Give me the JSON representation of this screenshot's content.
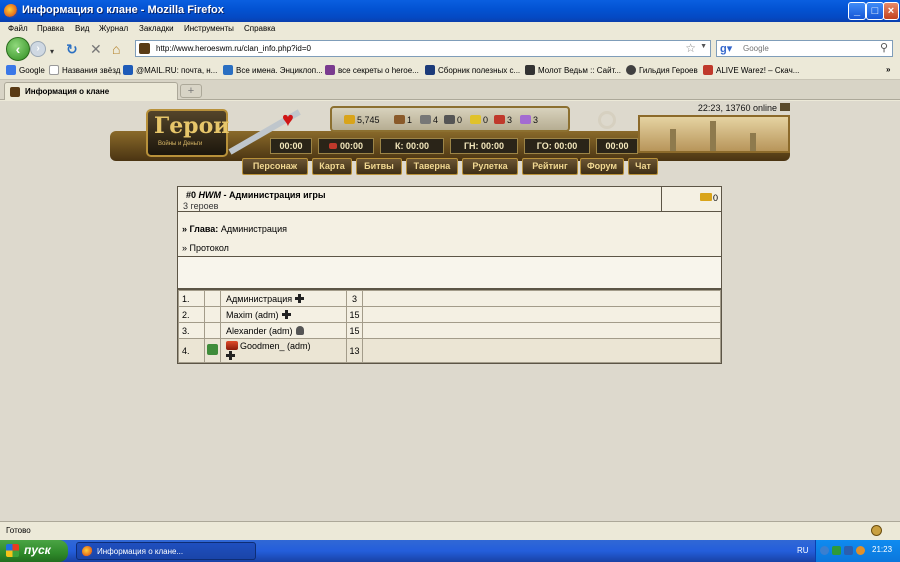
{
  "window": {
    "title": "Информация о клане - Mozilla Firefox",
    "minimize": "_",
    "maximize": "□",
    "close": "×"
  },
  "menu": [
    "Файл",
    "Правка",
    "Вид",
    "Журнал",
    "Закладки",
    "Инструменты",
    "Справка"
  ],
  "nav": {
    "url": "http://www.heroeswm.ru/clan_info.php?id=0",
    "search_placeholder": "Google"
  },
  "bookmarks": [
    {
      "label": "Google",
      "color": "#3b78e7"
    },
    {
      "label": "Названия звёзд",
      "color": "#dddddd"
    },
    {
      "label": "@MAIL.RU: почта, н...",
      "color": "#1e5bb8"
    },
    {
      "label": "Все имена. Энциклоп...",
      "color": "#2a6fc2"
    },
    {
      "label": "все секреты о heroe...",
      "color": "#7a3b8f"
    },
    {
      "label": "Сборник полезных с...",
      "color": "#1c3b7a"
    },
    {
      "label": "Молот Ведьм :: Сайт...",
      "color": "#333333"
    },
    {
      "label": "Гильдия Героев",
      "color": "#404040"
    },
    {
      "label": "ALIVE Warez! – Скач...",
      "color": "#c0392b"
    }
  ],
  "bookmarks_more": "»",
  "tab": {
    "label": "Информация о клане",
    "new_tab": "+"
  },
  "game": {
    "time_online": "22:23, 13760 online",
    "logo_title": "Герои",
    "logo_subtitle": "Войны и Деньги",
    "resources": [
      "5,745",
      "1",
      "4",
      "0",
      "0",
      "3",
      "3"
    ],
    "timers": [
      "00:00",
      "00:00",
      "К: 00:00",
      "ГН: 00:00",
      "ГО: 00:00",
      "00:00"
    ],
    "menu": [
      "Персонаж",
      "Карта",
      "Битвы",
      "Таверна",
      "Рулетка",
      "Рейтинг",
      "Форум",
      "Чат"
    ]
  },
  "clan": {
    "id_prefix": "#0",
    "tag": "HWM",
    "name_suffix": " - Администрация игры",
    "heroes_count": "3 героев",
    "gold": "0",
    "head_label": "» Глава:",
    "head_value": " Администрация",
    "protocol": "» Протокол",
    "members": [
      {
        "num": "1.",
        "name": "Администрация",
        "level": "3",
        "mark": "cross"
      },
      {
        "num": "2.",
        "name": "Maxim (adm)",
        "level": "15",
        "mark": "cross"
      },
      {
        "num": "3.",
        "name": "Alexander (adm)",
        "level": "15",
        "mark": "skull"
      },
      {
        "num": "4.",
        "name": "Goodmen_ (adm)",
        "level": "13",
        "mark": "cross"
      }
    ]
  },
  "statusbar": {
    "text": "Готово"
  },
  "taskbar": {
    "start": "пуск",
    "task": "Информация о клане...",
    "lang": "RU",
    "clock": "21:23"
  }
}
